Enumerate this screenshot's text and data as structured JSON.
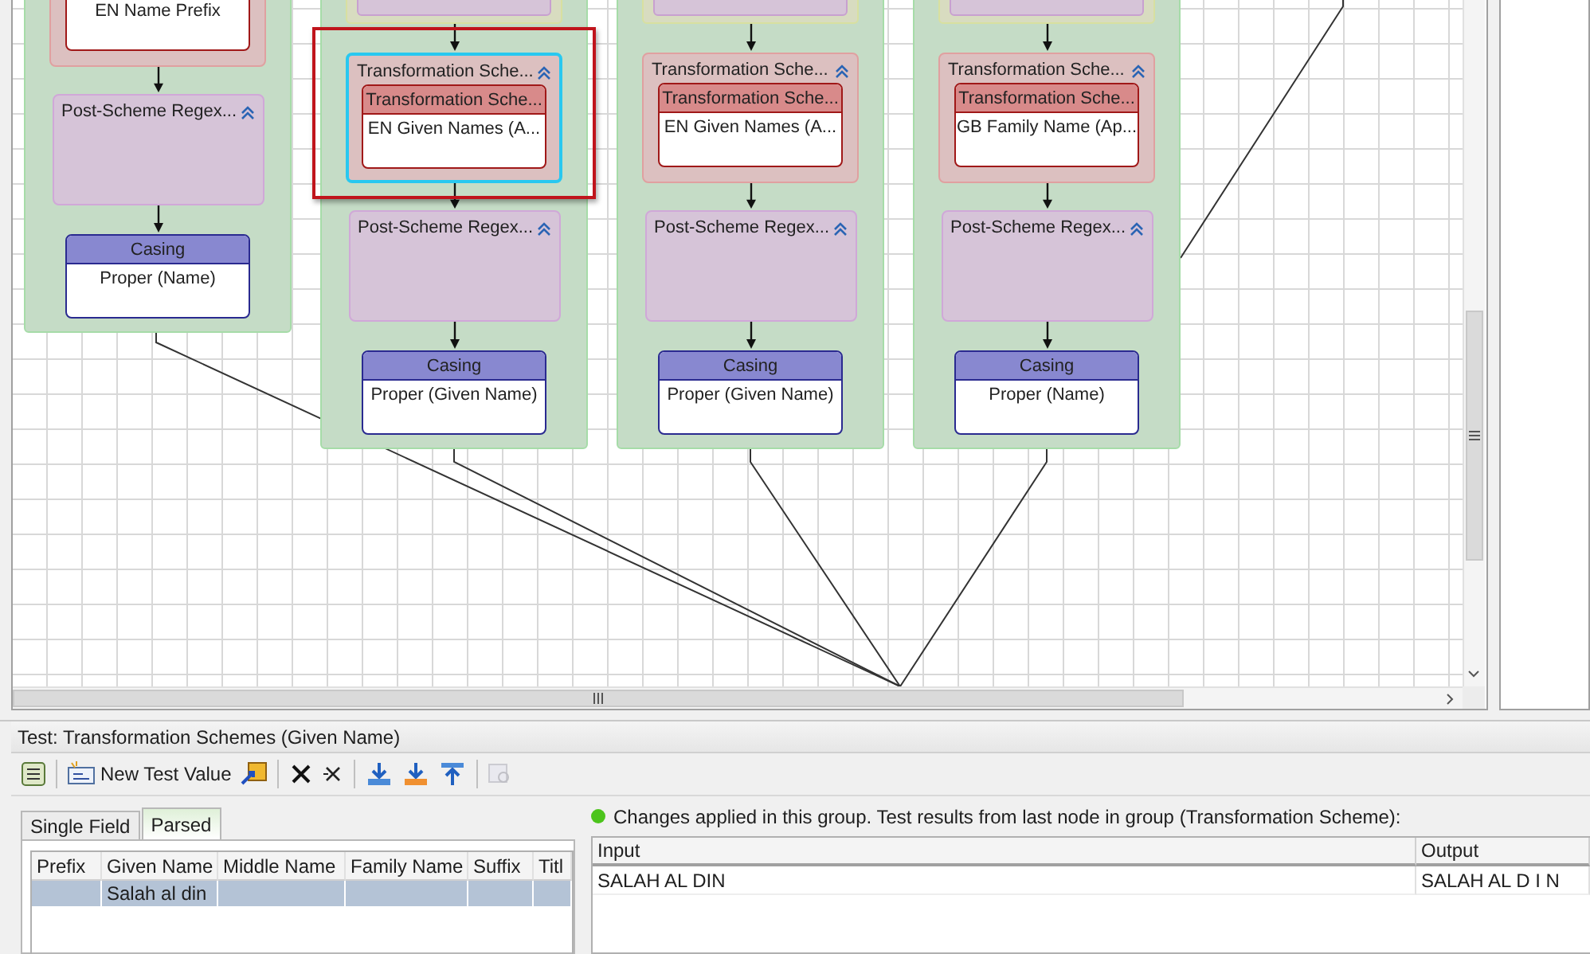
{
  "canvas": {
    "groups": [
      {
        "nodes": [
          {
            "kind": "scheme",
            "value": "EN Name Prefix",
            "selected": false,
            "annotated": false
          },
          {
            "kind": "regex",
            "title": "Post-Scheme Regex..."
          },
          {
            "kind": "casing",
            "title": "Casing",
            "value": "Proper (Name)"
          }
        ]
      },
      {
        "nodes": [
          {
            "kind": "stub"
          },
          {
            "kind": "scheme",
            "title": "Transformation Sche...",
            "header": "Transformation Sche...",
            "value": "EN Given Names (A...",
            "selected": true,
            "annotated": true
          },
          {
            "kind": "regex",
            "title": "Post-Scheme Regex..."
          },
          {
            "kind": "casing",
            "title": "Casing",
            "value": "Proper (Given Name)"
          }
        ]
      },
      {
        "nodes": [
          {
            "kind": "stub"
          },
          {
            "kind": "scheme",
            "title": "Transformation Sche...",
            "header": "Transformation Sche...",
            "value": "EN Given Names (A...",
            "selected": false,
            "annotated": false
          },
          {
            "kind": "regex",
            "title": "Post-Scheme Regex..."
          },
          {
            "kind": "casing",
            "title": "Casing",
            "value": "Proper (Given Name)"
          }
        ]
      },
      {
        "nodes": [
          {
            "kind": "stub"
          },
          {
            "kind": "scheme",
            "title": "Transformation Sche...",
            "header": "Transformation Sche...",
            "value": "GB Family Name (Ap...",
            "selected": false,
            "annotated": false
          },
          {
            "kind": "regex",
            "title": "Post-Scheme Regex..."
          },
          {
            "kind": "casing",
            "title": "Casing",
            "value": "Proper (Name)"
          }
        ]
      }
    ]
  },
  "test_panel": {
    "title": "Test: Transformation Schemes (Given Name)",
    "toolbar": [
      {
        "kind": "panel",
        "disabled": false
      },
      {
        "kind": "separator"
      },
      {
        "kind": "new-value",
        "label": "New Test Value",
        "disabled": false
      },
      {
        "kind": "link",
        "disabled": false
      },
      {
        "kind": "separator"
      },
      {
        "kind": "delete",
        "disabled": false
      },
      {
        "kind": "delete-all",
        "disabled": false
      },
      {
        "kind": "separator"
      },
      {
        "kind": "import",
        "disabled": false
      },
      {
        "kind": "import-all",
        "disabled": false
      },
      {
        "kind": "export",
        "disabled": false
      },
      {
        "kind": "separator"
      },
      {
        "kind": "preview",
        "disabled": true
      }
    ],
    "tabs": [
      {
        "label": "Single Field",
        "selected": false
      },
      {
        "label": "Parsed",
        "selected": true
      }
    ],
    "parsed_table": {
      "columns": [
        "Prefix",
        "Given Name",
        "Middle Name",
        "Family Name",
        "Suffix",
        "Titl"
      ],
      "rows": [
        {
          "cells": [
            null,
            "Salah al din",
            null,
            null,
            null,
            null
          ],
          "selected": true
        }
      ]
    },
    "status": "Changes applied in this group. Test results from last node in group (Transformation Scheme):",
    "results_table": {
      "columns": [
        "Input",
        "Output"
      ],
      "rows": [
        {
          "cells": [
            "SALAH AL DIN",
            "SALAH AL D I N"
          ]
        }
      ]
    }
  }
}
